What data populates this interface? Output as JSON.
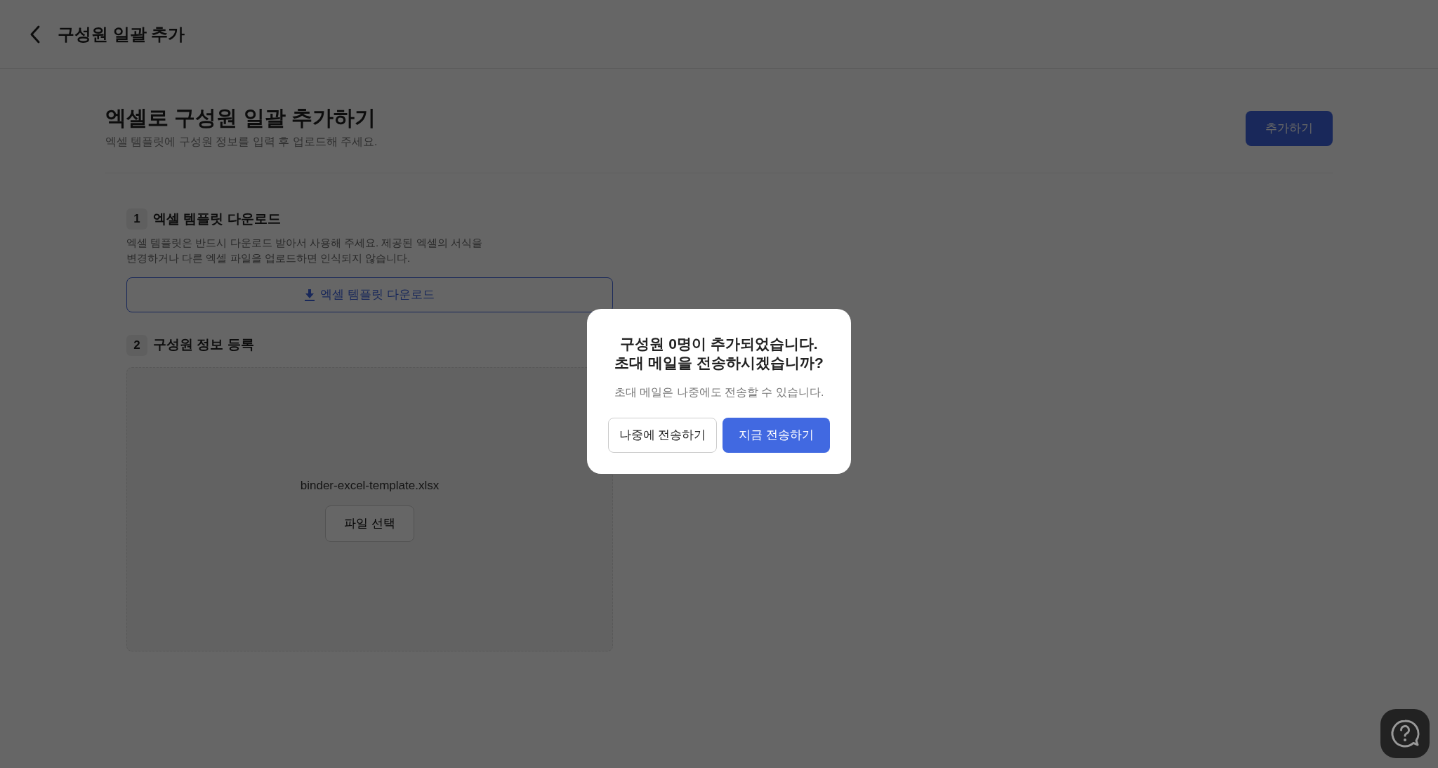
{
  "header": {
    "title": "구성원 일괄 추가"
  },
  "page": {
    "title": "엑셀로 구성원 일괄 추가하기",
    "subtitle": "엑셀 템플릿에 구성원 정보를 입력 후 업로드해 주세요.",
    "add_button": "추가하기"
  },
  "steps": [
    {
      "number": "1",
      "title": "엑셀 템플릿 다운로드",
      "description": "엑셀 템플릿은 반드시 다운로드 받아서 사용해 주세요. 제공된 엑셀의 서식을\n변경하거나 다른 엑셀 파일을 업로드하면 인식되지 않습니다.",
      "download_button": "엑셀 템플릿 다운로드"
    },
    {
      "number": "2",
      "title": "구성원 정보 등록",
      "file_name": "binder-excel-template.xlsx",
      "select_button": "파일 선택"
    }
  ],
  "dialog": {
    "title": "구성원 0명이 추가되었습니다.\n초대 메일을 전송하시겠습니까?",
    "message": "초대 메일은 나중에도 전송할 수 있습니다.",
    "buttons": [
      {
        "label": "나중에 전송하기",
        "kind": "secondary"
      },
      {
        "label": "지금 전송하기",
        "kind": "primary"
      }
    ]
  }
}
